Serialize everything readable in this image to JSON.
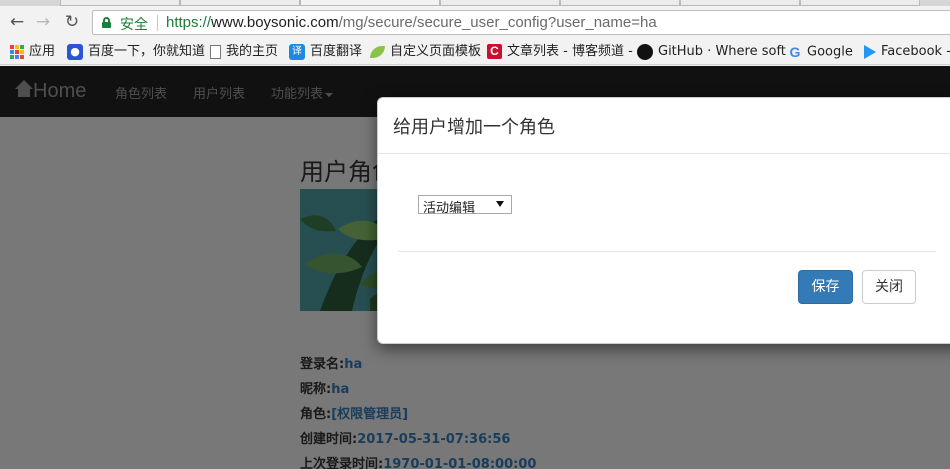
{
  "browser": {
    "secure_label": "安全",
    "url_scheme": "https://",
    "url_host": "www.boysonic.com",
    "url_rest": "/mg/secure/secure_user_config?user_name=ha",
    "bookmarks": [
      {
        "label": "应用",
        "icon": "apps-icon"
      },
      {
        "label": "百度一下，你就知道",
        "icon": "baidu-icon"
      },
      {
        "label": "我的主页",
        "icon": "page-icon"
      },
      {
        "label": "百度翻译",
        "icon": "baidu-translate-icon"
      },
      {
        "label": "自定义页面模板",
        "icon": "leaf-icon"
      },
      {
        "label": "文章列表 - 博客频道 -",
        "icon": "csdn-icon"
      },
      {
        "label": "GitHub · Where soft",
        "icon": "github-icon"
      },
      {
        "label": "Google",
        "icon": "google-icon"
      },
      {
        "label": "Facebook -",
        "icon": "facebook-icon"
      }
    ]
  },
  "navbar": {
    "brand": "Home",
    "links": [
      "角色列表",
      "用户列表",
      "功能列表"
    ]
  },
  "page": {
    "title": "用户角色",
    "info": [
      {
        "label": "登录名:",
        "value": "ha"
      },
      {
        "label": "昵称:",
        "value": "ha"
      },
      {
        "label": "角色:",
        "value": "[权限管理员]"
      },
      {
        "label": "创建时间:",
        "value": "2017-05-31-07:36:56"
      },
      {
        "label": "上次登录时间:",
        "value": "1970-01-01-08:00:00"
      }
    ]
  },
  "modal": {
    "title": "给用户增加一个角色",
    "select_value": "活动编辑",
    "save_label": "保存",
    "close_label": "关闭"
  },
  "colors": {
    "primary": "#337ab7",
    "navbar_bg": "#222222",
    "secure_green": "#188038"
  }
}
